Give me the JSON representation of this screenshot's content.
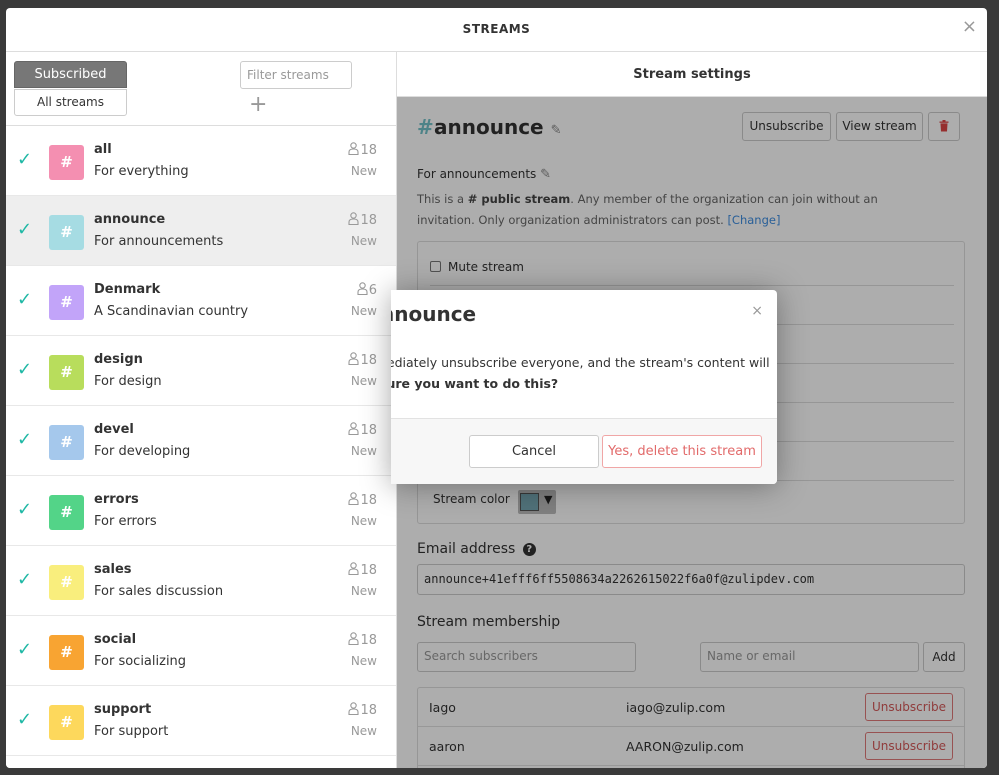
{
  "modal": {
    "title": "STREAMS",
    "close_glyph": "×"
  },
  "left": {
    "tab_subscribed": "Subscribed",
    "tab_all": "All streams",
    "filter_placeholder": "Filter streams",
    "add_glyph": "+"
  },
  "streams": [
    {
      "name": "all",
      "desc": "For everything",
      "count": "18",
      "status": "New",
      "color": "#f48fb1"
    },
    {
      "name": "announce",
      "desc": "For announcements",
      "count": "18",
      "status": "New",
      "color": "#a6dce3"
    },
    {
      "name": "Denmark",
      "desc": "A Scandinavian country",
      "count": "6",
      "status": "New",
      "color": "#c2a4f9"
    },
    {
      "name": "design",
      "desc": "For design",
      "count": "18",
      "status": "New",
      "color": "#b8dd5c"
    },
    {
      "name": "devel",
      "desc": "For developing",
      "count": "18",
      "status": "New",
      "color": "#a5c8ec"
    },
    {
      "name": "errors",
      "desc": "For errors",
      "count": "18",
      "status": "New",
      "color": "#53d488"
    },
    {
      "name": "sales",
      "desc": "For sales discussion",
      "count": "18",
      "status": "New",
      "color": "#f9ee7d"
    },
    {
      "name": "social",
      "desc": "For socializing",
      "count": "18",
      "status": "New",
      "color": "#f8a432"
    },
    {
      "name": "support",
      "desc": "For support",
      "count": "18",
      "status": "New",
      "color": "#fdd85c"
    }
  ],
  "hash": "#",
  "check": "✓",
  "right": {
    "header": "Stream settings",
    "stream_name": "announce",
    "btn_unsubscribe": "Unsubscribe",
    "btn_view": "View stream",
    "description": "For announcements",
    "pub_pre": "This is a ",
    "pub_bold": "# public stream",
    "pub_post": ". Any member of the organization can join without an invitation. Only organization administrators can post.",
    "change": "[Change]",
    "mute_label": "Mute stream",
    "color_label": "Stream color",
    "email_label": "Email address",
    "email_value": "announce+41efff6ff5508634a2262615022f6a0f@zulipdev.com",
    "membership_label": "Stream membership",
    "search_subs_placeholder": "Search subscribers",
    "name_email_placeholder": "Name or email",
    "add_label": "Add",
    "members": [
      {
        "name": "Iago",
        "email": "iago@zulip.com",
        "action": "Unsubscribe"
      },
      {
        "name": "aaron",
        "email": "AARON@zulip.com",
        "action": "Unsubscribe"
      }
    ]
  },
  "dialog": {
    "title": "nnounce",
    "close_glyph": "×",
    "line1": "nediately unsubscribe everyone, and the stream's content will",
    "line2": "sure you want to do this?",
    "cancel": "Cancel",
    "confirm": "Yes, delete this stream"
  }
}
